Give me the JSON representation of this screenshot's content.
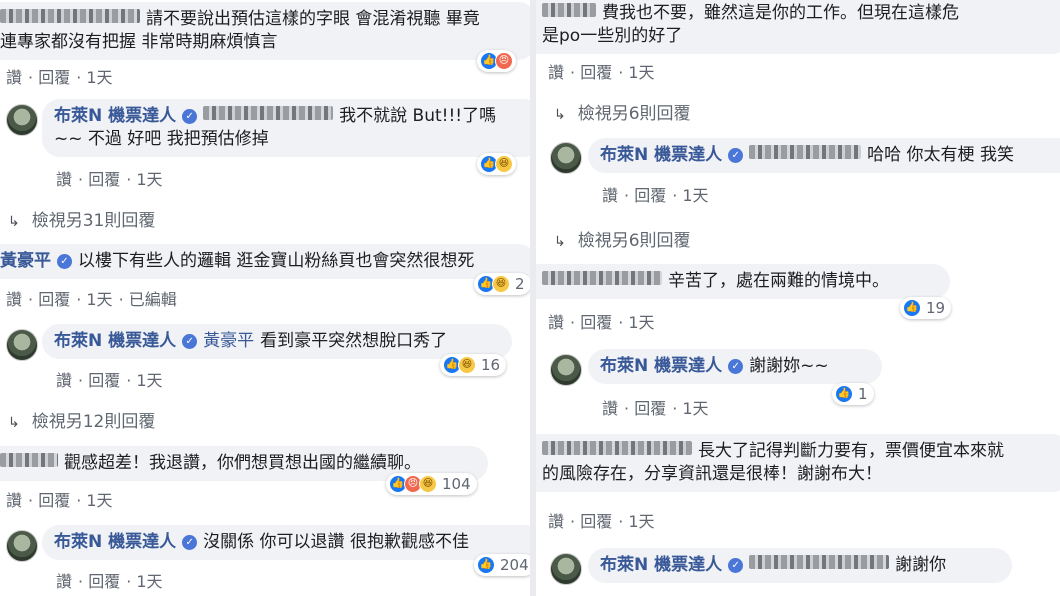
{
  "left": {
    "c1": {
      "text1": "請不要說出預估這樣的字眼 會混淆視聽 畢竟",
      "text2": "連專家都沒有把握 非常時期麻煩慎言",
      "actions": [
        "讚",
        "回覆",
        "1天"
      ]
    },
    "r1": {
      "author": "布萊N 機票達人",
      "text1": "我不就說 But!!!了嗎",
      "text2": "~~ 不過 好吧 我把預估修掉",
      "actions": [
        "讚",
        "回覆",
        "1天"
      ]
    },
    "more1": "檢視另31則回覆",
    "c2": {
      "author": "黃豪平",
      "text": "以樓下有些人的邏輯 逛金寶山粉絲頁也會突然很想死",
      "actions": [
        "讚",
        "回覆",
        "1天",
        "已編輯"
      ],
      "count": "2"
    },
    "r2": {
      "author": "布萊N 機票達人",
      "tag": "黃豪平",
      "text": "看到豪平突然想脫口秀了",
      "actions": [
        "讚",
        "回覆",
        "1天"
      ],
      "count": "16"
    },
    "more2": "檢視另12則回覆",
    "c3": {
      "text": "觀感超差！我退讚，你們想買想出國的繼續聊。",
      "actions": [
        "讚",
        "回覆",
        "1天"
      ],
      "count": "104"
    },
    "r3": {
      "author": "布萊N 機票達人",
      "text": "沒關係 你可以退讚 很抱歉觀感不佳",
      "actions": [
        "讚",
        "回覆",
        "1天"
      ],
      "count": "204"
    }
  },
  "right": {
    "c1": {
      "text1": "費我也不要，雖然這是你的工作。但現在這樣危",
      "text2": "是po一些別的好了",
      "actions": [
        "讚",
        "回覆",
        "1天"
      ]
    },
    "more1": "檢視另6則回覆",
    "r1": {
      "author": "布萊N 機票達人",
      "text": "哈哈 你太有梗 我笑",
      "actions": [
        "讚",
        "回覆",
        "1天"
      ]
    },
    "more2": "檢視另6則回覆",
    "c2": {
      "text": "辛苦了，處在兩難的情境中。",
      "actions": [
        "讚",
        "回覆",
        "1天"
      ],
      "count": "19"
    },
    "r2": {
      "author": "布萊N 機票達人",
      "text": "謝謝妳~~",
      "actions": [
        "讚",
        "回覆",
        "1天"
      ],
      "count": "1"
    },
    "c3": {
      "text1": "長大了記得判斷力要有，票價便宜本來就",
      "text2": "的風險存在，分享資訊還是很棒！謝謝布大！",
      "actions": [
        "讚",
        "回覆",
        "1天"
      ]
    },
    "r3": {
      "author": "布萊N 機票達人",
      "text": "謝謝你"
    }
  },
  "colors": {
    "link": "#385898",
    "bubble": "#f0f2f5",
    "meta": "#606770",
    "like": "#1877f2"
  },
  "icons": [
    "like-icon",
    "angry-icon",
    "haha-icon",
    "verified-icon",
    "reply-arrow-icon"
  ]
}
